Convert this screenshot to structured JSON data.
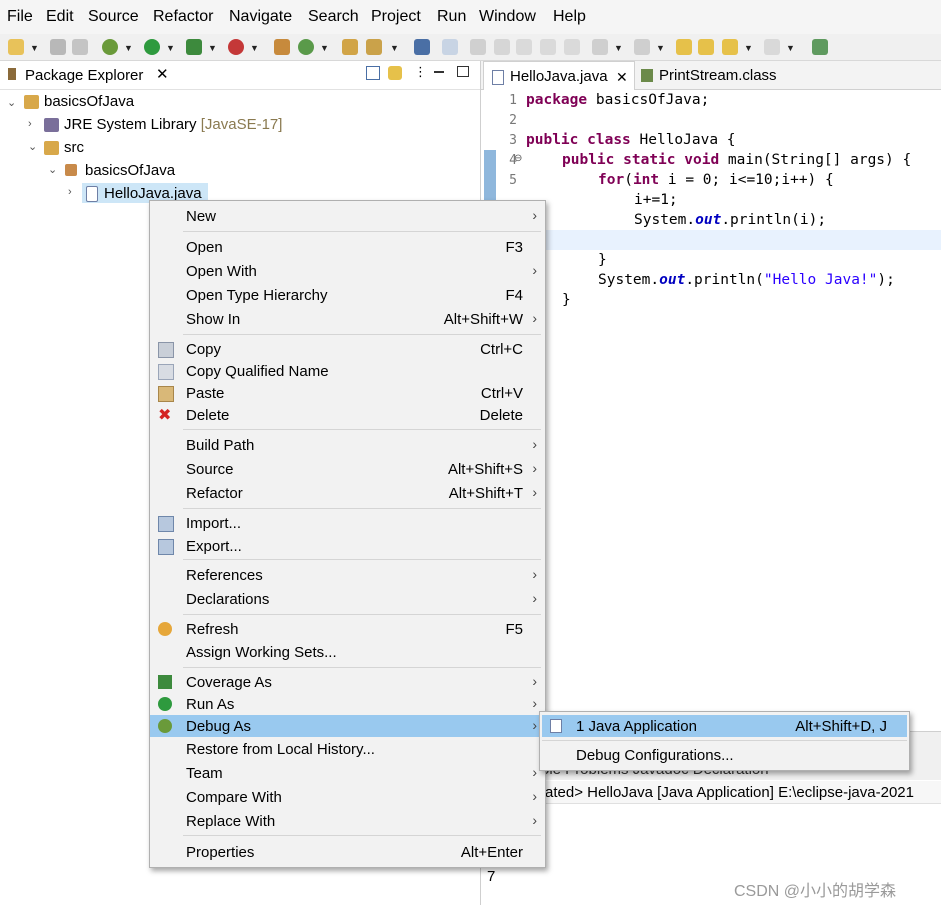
{
  "menubar": [
    "File",
    "Edit",
    "Source",
    "Refactor",
    "Navigate",
    "Search",
    "Project",
    "Run",
    "Window",
    "Help"
  ],
  "package_explorer": {
    "title": "Package Explorer",
    "tree": [
      {
        "label": "basicsOfJava",
        "extra": ""
      },
      {
        "label": "JRE System Library",
        "extra": "[JavaSE-17]"
      },
      {
        "label": "src",
        "extra": ""
      },
      {
        "label": "basicsOfJava",
        "extra": ""
      },
      {
        "label": "HelloJava.java",
        "extra": ""
      }
    ]
  },
  "editor": {
    "tabs": [
      "HelloJava.java",
      "PrintStream.class"
    ],
    "line_numbers": [
      "1",
      "2",
      "3",
      "4",
      "5"
    ],
    "code": {
      "l1a": "package",
      "l1b": " basicsOfJava;",
      "l3a": "public",
      "l3b": " ",
      "l3c": "class",
      "l3d": " HelloJava {",
      "l4a": "public",
      "l4b": "static",
      "l4c": "void",
      "l4d": " main(String[] args) {",
      "l5a": "for",
      "l5b": "(",
      "l5c": "int",
      "l5d": " i = 0; i<=10;i++) {",
      "l6": "i+=1;",
      "l7a": "System.",
      "l7b": "out",
      "l7c": ".println(i);",
      "l9": "}",
      "l10a": "System.",
      "l10b": "out",
      "l10c": ".println(",
      "l10d": "\"Hello Java!\"",
      "l10e": ");",
      "l11": "}"
    }
  },
  "console": {
    "tabs_partial": "ole  Problems   Javadoc   Declaration",
    "status": "ated> HelloJava [Java Application] E:\\eclipse-java-2021",
    "output": "7"
  },
  "context_menu": {
    "groups": [
      [
        {
          "label": "New",
          "shortcut": "",
          "submenu": true
        }
      ],
      [
        {
          "label": "Open",
          "shortcut": "F3",
          "submenu": false
        },
        {
          "label": "Open With",
          "shortcut": "",
          "submenu": true
        },
        {
          "label": "Open Type Hierarchy",
          "shortcut": "F4",
          "submenu": false
        },
        {
          "label": "Show In",
          "shortcut": "Alt+Shift+W",
          "submenu": true
        }
      ],
      [
        {
          "label": "Copy",
          "shortcut": "Ctrl+C",
          "submenu": false
        },
        {
          "label": "Copy Qualified Name",
          "shortcut": "",
          "submenu": false
        },
        {
          "label": "Paste",
          "shortcut": "Ctrl+V",
          "submenu": false
        },
        {
          "label": "Delete",
          "shortcut": "Delete",
          "submenu": false
        }
      ],
      [
        {
          "label": "Build Path",
          "shortcut": "",
          "submenu": true
        },
        {
          "label": "Source",
          "shortcut": "Alt+Shift+S",
          "submenu": true
        },
        {
          "label": "Refactor",
          "shortcut": "Alt+Shift+T",
          "submenu": true
        }
      ],
      [
        {
          "label": "Import...",
          "shortcut": "",
          "submenu": false
        },
        {
          "label": "Export...",
          "shortcut": "",
          "submenu": false
        }
      ],
      [
        {
          "label": "References",
          "shortcut": "",
          "submenu": true
        },
        {
          "label": "Declarations",
          "shortcut": "",
          "submenu": true
        }
      ],
      [
        {
          "label": "Refresh",
          "shortcut": "F5",
          "submenu": false
        },
        {
          "label": "Assign Working Sets...",
          "shortcut": "",
          "submenu": false
        }
      ],
      [
        {
          "label": "Coverage As",
          "shortcut": "",
          "submenu": true
        },
        {
          "label": "Run As",
          "shortcut": "",
          "submenu": true
        },
        {
          "label": "Debug As",
          "shortcut": "",
          "submenu": true
        },
        {
          "label": "Restore from Local History...",
          "shortcut": "",
          "submenu": false
        },
        {
          "label": "Team",
          "shortcut": "",
          "submenu": true
        },
        {
          "label": "Compare With",
          "shortcut": "",
          "submenu": true
        },
        {
          "label": "Replace With",
          "shortcut": "",
          "submenu": true
        }
      ],
      [
        {
          "label": "Properties",
          "shortcut": "Alt+Enter",
          "submenu": false
        }
      ]
    ]
  },
  "submenu": {
    "item1_label": "1 Java Application",
    "item1_shortcut": "Alt+Shift+D, J",
    "item2_label": "Debug Configurations..."
  },
  "watermark": "CSDN @小小的胡学森",
  "colors": {
    "highlight": "#99c9ef",
    "keyword": "#7f0055",
    "string": "#2a00ff",
    "field": "#0000c0"
  }
}
